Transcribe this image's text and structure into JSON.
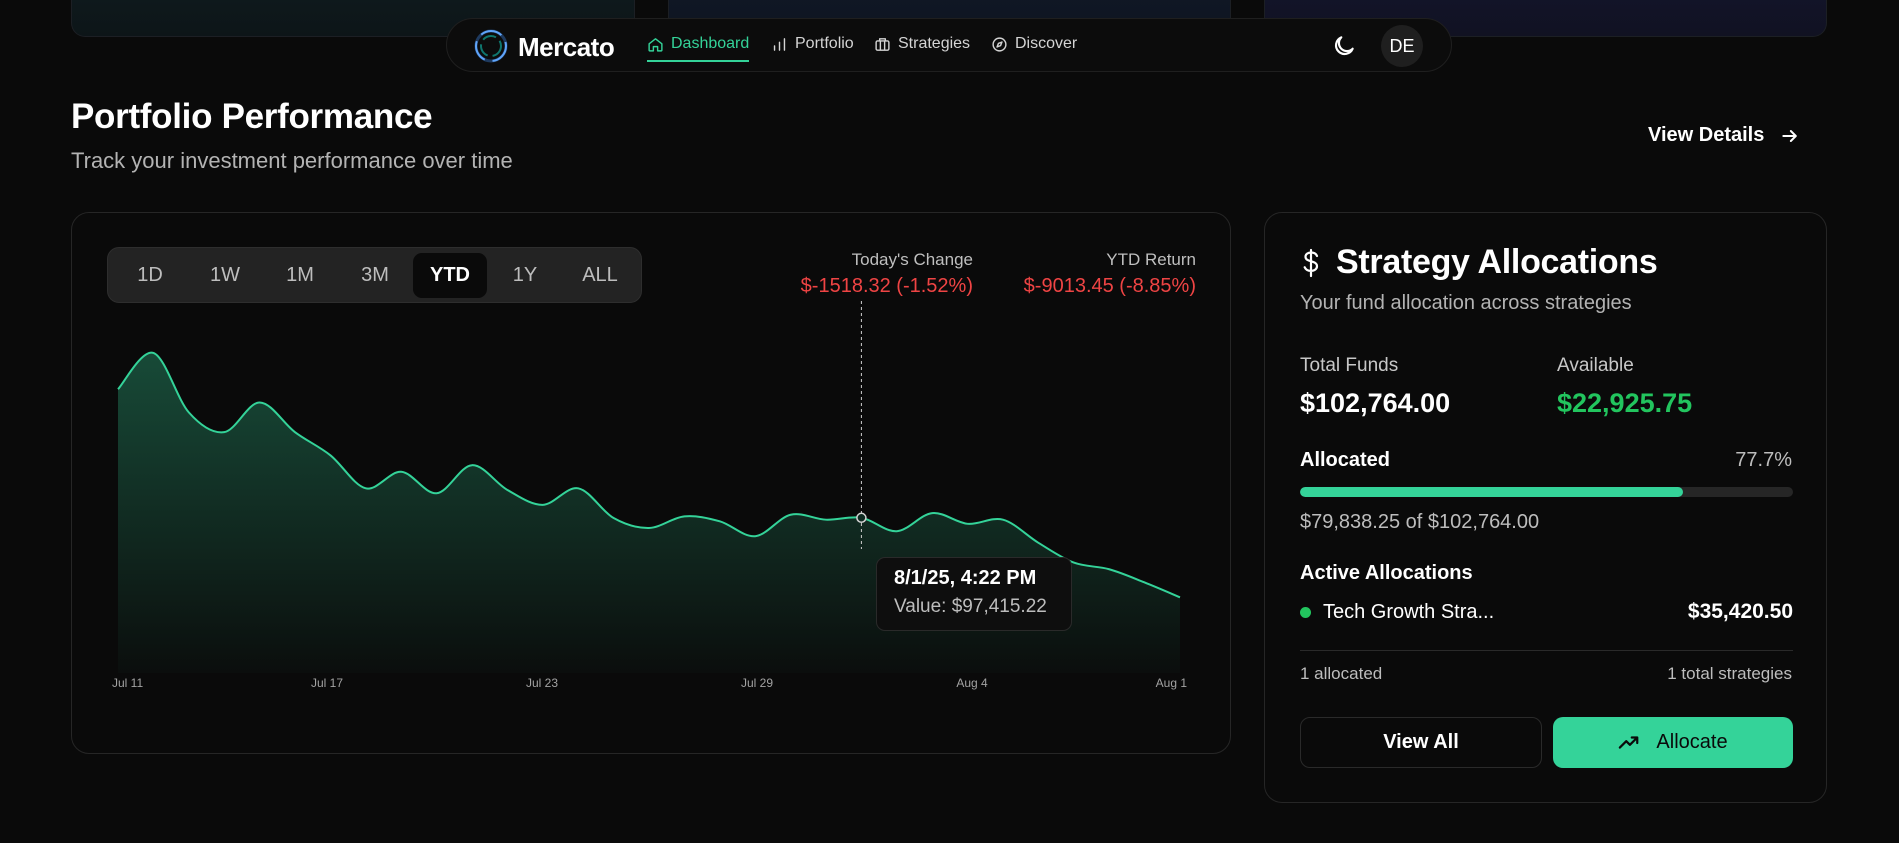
{
  "nav": {
    "brand": "Mercato",
    "links": [
      {
        "label": "Dashboard",
        "icon": "home-icon",
        "active": true
      },
      {
        "label": "Portfolio",
        "icon": "bar-chart-icon",
        "active": false
      },
      {
        "label": "Strategies",
        "icon": "briefcase-icon",
        "active": false
      },
      {
        "label": "Discover",
        "icon": "compass-icon",
        "active": false
      }
    ],
    "theme_icon": "moon-icon",
    "avatar_initials": "DE"
  },
  "header": {
    "title": "Portfolio Performance",
    "subtitle": "Track your investment performance over time",
    "view_details": "View Details"
  },
  "performance": {
    "ranges": [
      "1D",
      "1W",
      "1M",
      "3M",
      "YTD",
      "1Y",
      "ALL"
    ],
    "active_range": "YTD",
    "todays_change_label": "Today's Change",
    "todays_change_value": "$-1518.32 (-1.52%)",
    "ytd_return_label": "YTD Return",
    "ytd_return_value": "$-9013.45 (-8.85%)",
    "tooltip": {
      "date": "8/1/25, 4:22 PM",
      "value": "Value: $97,415.22"
    }
  },
  "chart_data": {
    "type": "area",
    "x_tick_labels": [
      "Jul 11",
      "Jul 17",
      "Jul 23",
      "Jul 29",
      "Aug 4",
      "Aug 1"
    ],
    "x": [
      "Jul 11",
      "Jul 12",
      "Jul 13",
      "Jul 14",
      "Jul 15",
      "Jul 16",
      "Jul 17",
      "Jul 18",
      "Jul 19",
      "Jul 20",
      "Jul 21",
      "Jul 22",
      "Jul 23",
      "Jul 24",
      "Jul 25",
      "Jul 26",
      "Jul 27",
      "Jul 28",
      "Jul 29",
      "Jul 30",
      "Jul 31",
      "Aug 1",
      "Aug 2",
      "Aug 3",
      "Aug 4",
      "Aug 5",
      "Aug 6",
      "Aug 7",
      "Aug 8",
      "Aug 9",
      "Aug 10"
    ],
    "values": [
      105200,
      107400,
      103800,
      102600,
      104400,
      102600,
      101200,
      99200,
      100200,
      98900,
      100600,
      99100,
      98200,
      99200,
      97400,
      96800,
      97500,
      97200,
      96300,
      97600,
      97300,
      97415,
      96600,
      97700,
      97050,
      97300,
      95900,
      94700,
      94300,
      93500,
      92600
    ],
    "series_color": "#34d399",
    "highlight_x": "Aug 1",
    "highlight_value": 97415.22,
    "grid": false,
    "legend": "none"
  },
  "allocations": {
    "icon": "dollar-icon",
    "title": "Strategy Allocations",
    "subtitle": "Your fund allocation across strategies",
    "total_funds_label": "Total Funds",
    "total_funds_value": "$102,764.00",
    "available_label": "Available",
    "available_value": "$22,925.75",
    "allocated_label": "Allocated",
    "allocated_pct": "77.7%",
    "allocated_fraction": 0.777,
    "allocated_of": "$79,838.25 of $102,764.00",
    "active_title": "Active Allocations",
    "items": [
      {
        "name": "Tech Growth Stra...",
        "amount": "$35,420.50",
        "color": "#22c55e"
      }
    ],
    "footer_left": "1 allocated",
    "footer_right": "1 total strategies",
    "view_all": "View All",
    "allocate": "Allocate",
    "allocate_icon": "trending-up-icon"
  }
}
